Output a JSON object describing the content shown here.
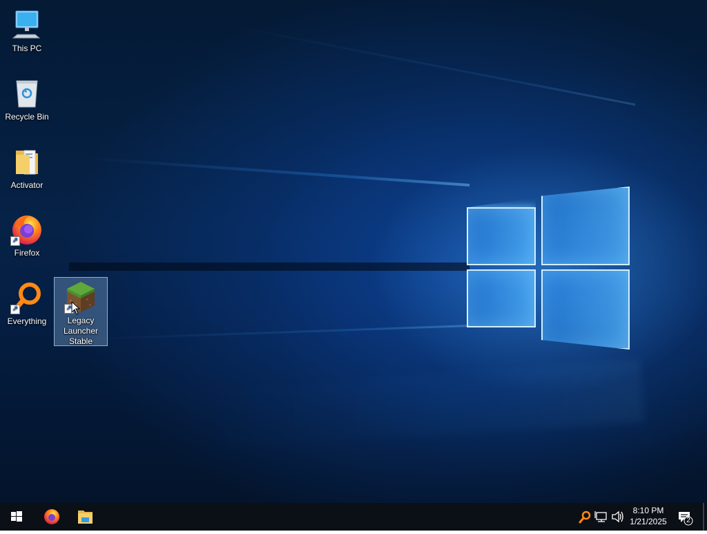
{
  "desktop": {
    "icons": [
      {
        "label": "This PC",
        "icon": "computer-icon"
      },
      {
        "label": "Recycle Bin",
        "icon": "recycle-bin-icon"
      },
      {
        "label": "Activator",
        "icon": "folder-icon"
      },
      {
        "label": "Firefox",
        "icon": "firefox-icon",
        "shortcut": true
      },
      {
        "label": "Everything",
        "icon": "everything-search-icon",
        "shortcut": true
      },
      {
        "label": "Legacy Launcher Stable",
        "icon": "minecraft-grass-block-icon",
        "shortcut": true,
        "selected": true
      }
    ]
  },
  "taskbar": {
    "start_icon": "windows-start-icon",
    "pinned": [
      {
        "name": "Firefox",
        "icon": "firefox-icon"
      },
      {
        "name": "File Explorer",
        "icon": "file-explorer-icon"
      }
    ],
    "tray": {
      "icons": [
        "everything-search-icon",
        "network-icon",
        "volume-icon"
      ],
      "time": "8:10 PM",
      "date": "1/21/2025",
      "notification_count": "2"
    }
  },
  "colors": {
    "taskbar": "#0b0f16",
    "selection": "#8cb4dc",
    "accent": "#1e7fe0"
  }
}
